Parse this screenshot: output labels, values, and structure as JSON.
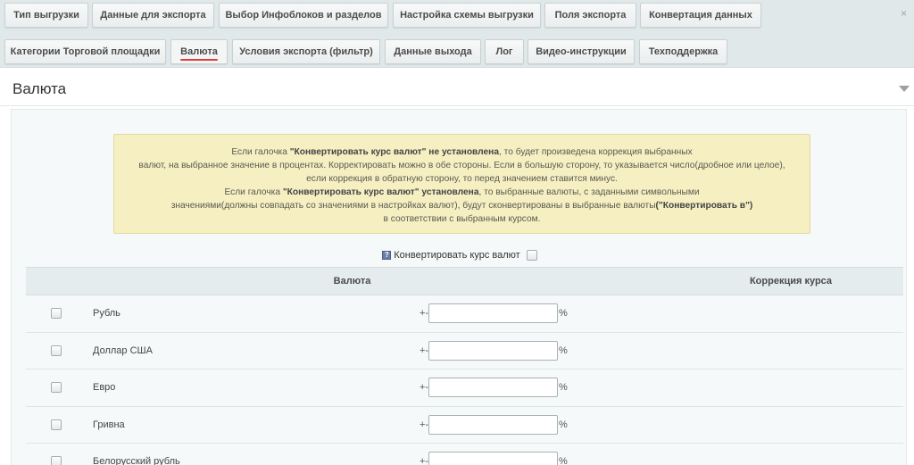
{
  "tabs_top": [
    {
      "label": "Тип выгрузки",
      "name": "tab-export-type"
    },
    {
      "label": "Данные для экспорта",
      "name": "tab-export-data"
    },
    {
      "label": "Выбор Инфоблоков и разделов",
      "name": "tab-iblock-select"
    },
    {
      "label": "Настройка схемы выгрузки",
      "name": "tab-scheme-settings"
    },
    {
      "label": "Поля экспорта",
      "name": "tab-export-fields"
    },
    {
      "label": "Конвертация данных",
      "name": "tab-data-conversion"
    }
  ],
  "tabs_second": [
    {
      "label": "Категории Торговой площадки",
      "name": "tab-marketplace-categories"
    },
    {
      "label": "Валюта",
      "name": "tab-currency",
      "active": true
    },
    {
      "label": "Условия экспорта (фильтр)",
      "name": "tab-export-filter"
    },
    {
      "label": "Данные выхода",
      "name": "tab-output-data"
    },
    {
      "label": "Лог",
      "name": "tab-log"
    },
    {
      "label": "Видео-инструкции",
      "name": "tab-video"
    },
    {
      "label": "Техподдержка",
      "name": "tab-support"
    }
  ],
  "pin_glyph": "×",
  "panel": {
    "title": "Валюта"
  },
  "notice": {
    "l1a": "Если галочка ",
    "l1b": "\"Конвертировать курс валют\" не установлена",
    "l1c": ", то будет произведена коррекция выбранных",
    "l2": "валют, на выбранное значение в процентах. Корректировать можно в обе стороны. Если в большую сторону, то указывается число(дробное или целое),",
    "l3": "если коррекция в обратную сторону, то перед значением ставится минус.",
    "l4a": "Если галочка ",
    "l4b": "\"Конвертировать курс валют\" установлена",
    "l4c": ", то выбранные валюты, с заданными символьными",
    "l5a": "значениями(должны совпадать со значениями в настройках валют), будут сконвертированы в выбранные валюты",
    "l5b": "(\"Конвертировать в\")",
    "l6": "в соответствии с выбранным курсом."
  },
  "convert": {
    "help_glyph": "?",
    "label": "Конвертировать курс валют"
  },
  "table": {
    "headers": {
      "currency": "Валюта",
      "correction": "Коррекция курса"
    },
    "plusminus": "+-",
    "percent": "%",
    "rows": [
      {
        "name": "Рубль",
        "value": ""
      },
      {
        "name": "Доллар США",
        "value": ""
      },
      {
        "name": "Евро",
        "value": ""
      },
      {
        "name": "Гривна",
        "value": ""
      },
      {
        "name": "Белорусский рубль",
        "value": ""
      }
    ]
  }
}
